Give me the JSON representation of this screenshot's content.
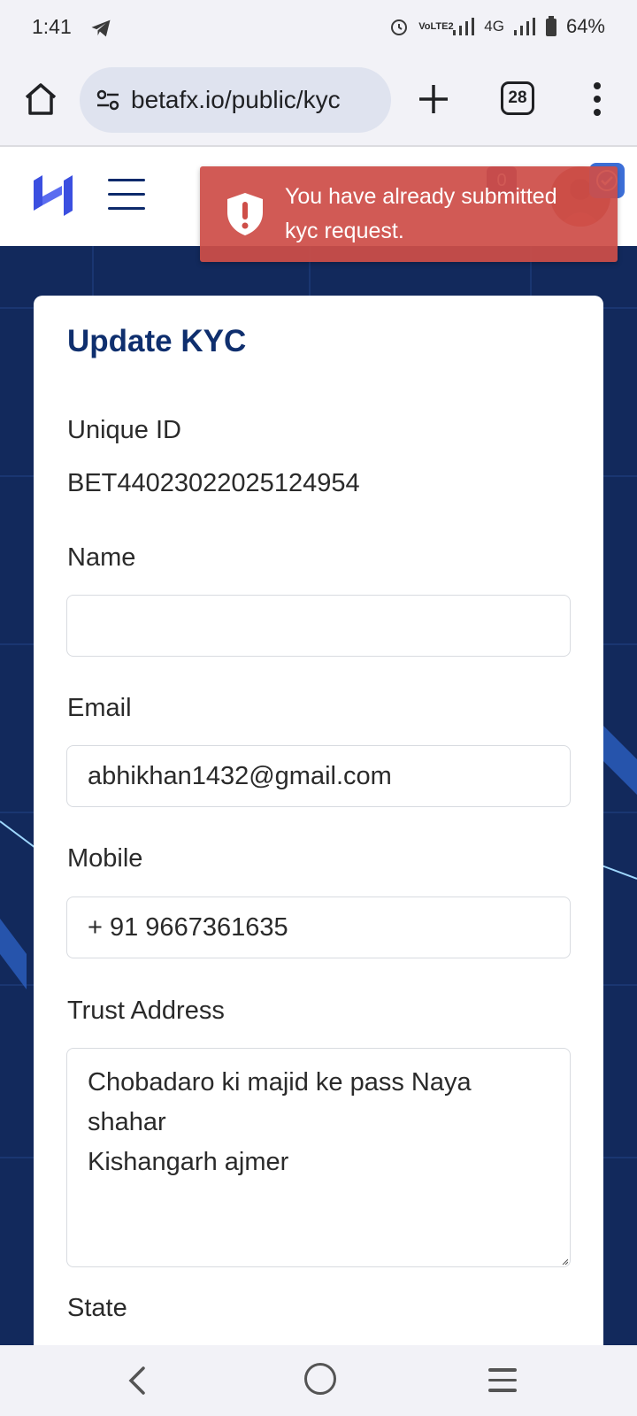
{
  "status_bar": {
    "time": "1:41",
    "network_label": "4G",
    "volte_label": "VoLTE2",
    "battery": "64%"
  },
  "browser": {
    "url": "betafx.io/public/kyc",
    "tab_count": "28"
  },
  "header": {
    "notification_count": "0"
  },
  "toast": {
    "message": "You have already submitted kyc request."
  },
  "form": {
    "title": "Update KYC",
    "unique_id_label": "Unique ID",
    "unique_id_value": "BET44023022025124954",
    "name_label": "Name",
    "name_value": "",
    "email_label": "Email",
    "email_value": "abhikhan1432@gmail.com",
    "mobile_label": "Mobile",
    "mobile_value": "+ 91 9667361635",
    "trust_address_label": "Trust Address",
    "trust_address_lines": [
      "Chobadaro ki majid ke pass Naya",
      "shahar",
      "Kishangarh ajmer"
    ],
    "state_label": "State"
  },
  "colors": {
    "brand": "#0f2f6e",
    "logo": "#3b4fe0",
    "toast_bg": "#ce4e48",
    "page_bg": "#12295c"
  }
}
